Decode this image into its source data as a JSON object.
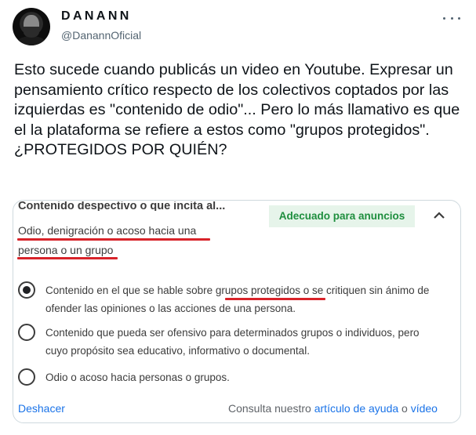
{
  "tweet": {
    "display_name": "DANANN",
    "handle": "@DanannOficial",
    "text": "Esto sucede cuando publicás un video en Youtube. Expresar un pensamiento crítico respecto de los colectivos coptados por las izquierdas es \"contenido de odio\"... Pero lo más llamativo es que el la plataforma se refiere a estos como \"grupos protegidos\". ¿PROTEGIDOS POR QUIÉN?"
  },
  "media": {
    "title": "Contenido despectivo o que incita al...",
    "badge": "Adecuado para anuncios",
    "subtitle_line1": "Odio, denigración o acoso hacia una",
    "subtitle_line2": "persona o un grupo",
    "options": [
      {
        "pre": "Contenido en el que se hable sobre ",
        "highlight": "grupos protegidos",
        "post": " o se critiquen sin ánimo de ofender las opiniones o las acciones de una persona.",
        "checked": true
      },
      {
        "text": "Contenido que pueda ser ofensivo para determinados grupos o individuos, pero cuyo propósito sea educativo, informativo o documental.",
        "checked": false
      },
      {
        "text": "Odio o acoso hacia personas o grupos.",
        "checked": false
      }
    ],
    "undo_label": "Deshacer",
    "footer": {
      "prefix": "Consulta nuestro ",
      "help_link": "artículo de ayuda",
      "middle": " o ",
      "video_link": "vídeo"
    }
  },
  "colors": {
    "badge_bg": "#e6f4ea",
    "badge_text": "#1e8e3e",
    "annotation_red": "#d8232a",
    "link_blue": "#1a73e8"
  },
  "icons": {
    "more": "more-horizontal-icon",
    "collapse": "chevron-up-icon"
  }
}
